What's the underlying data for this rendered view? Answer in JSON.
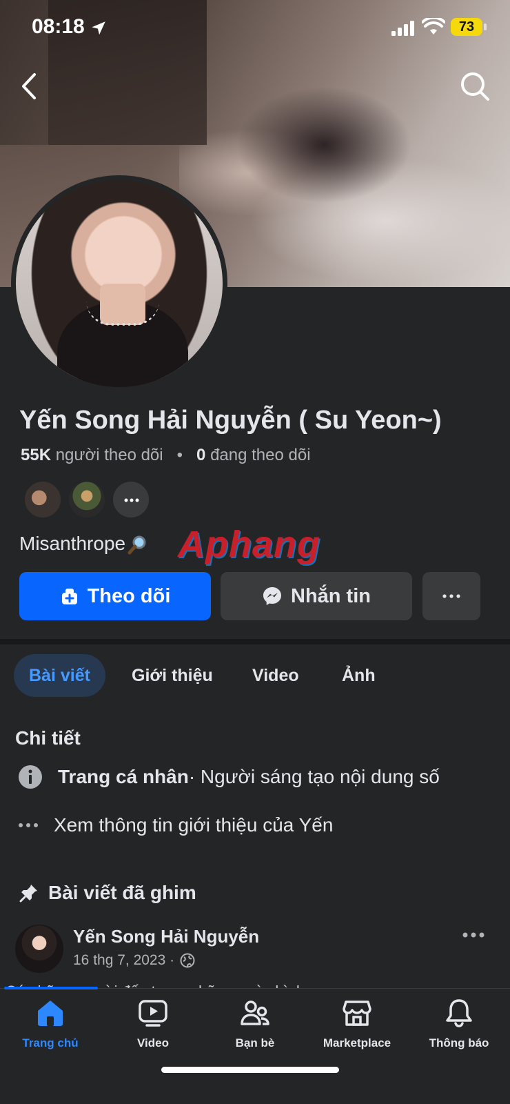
{
  "status": {
    "time": "08:18",
    "battery": "73"
  },
  "profile": {
    "name": "Yến Song Hải Nguyễn ( Su Yeon~)",
    "followers_count": "55K",
    "followers_label": "người theo dõi",
    "following_count": "0",
    "following_label": "đang theo dõi",
    "bio": "Misanthrope",
    "watermark": "Aphang"
  },
  "actions": {
    "follow_label": "Theo dõi",
    "message_label": "Nhắn tin"
  },
  "tabs": [
    {
      "label": "Bài viết"
    },
    {
      "label": "Giới thiệu"
    },
    {
      "label": "Video"
    },
    {
      "label": "Ảnh"
    }
  ],
  "details": {
    "title": "Chi tiết",
    "type_label": "Trang cá nhân",
    "type_value": " · Người sáng tạo nội dung số",
    "see_about": "Xem thông tin giới thiệu của Yến"
  },
  "pinned": {
    "title": "Bài viết đã ghim",
    "author": "Yến Song Hải Nguyễn",
    "date": "16 thg 7, 2023 ·",
    "snippet": "Có những người đến trong những ngày bình"
  },
  "bottom_nav": [
    {
      "label": "Trang chủ"
    },
    {
      "label": "Video"
    },
    {
      "label": "Bạn bè"
    },
    {
      "label": "Marketplace"
    },
    {
      "label": "Thông báo"
    }
  ],
  "colors": {
    "accent": "#0866ff",
    "background": "#242526",
    "active_tab_bg": "#263951",
    "active_tab_text": "#4599ff"
  }
}
